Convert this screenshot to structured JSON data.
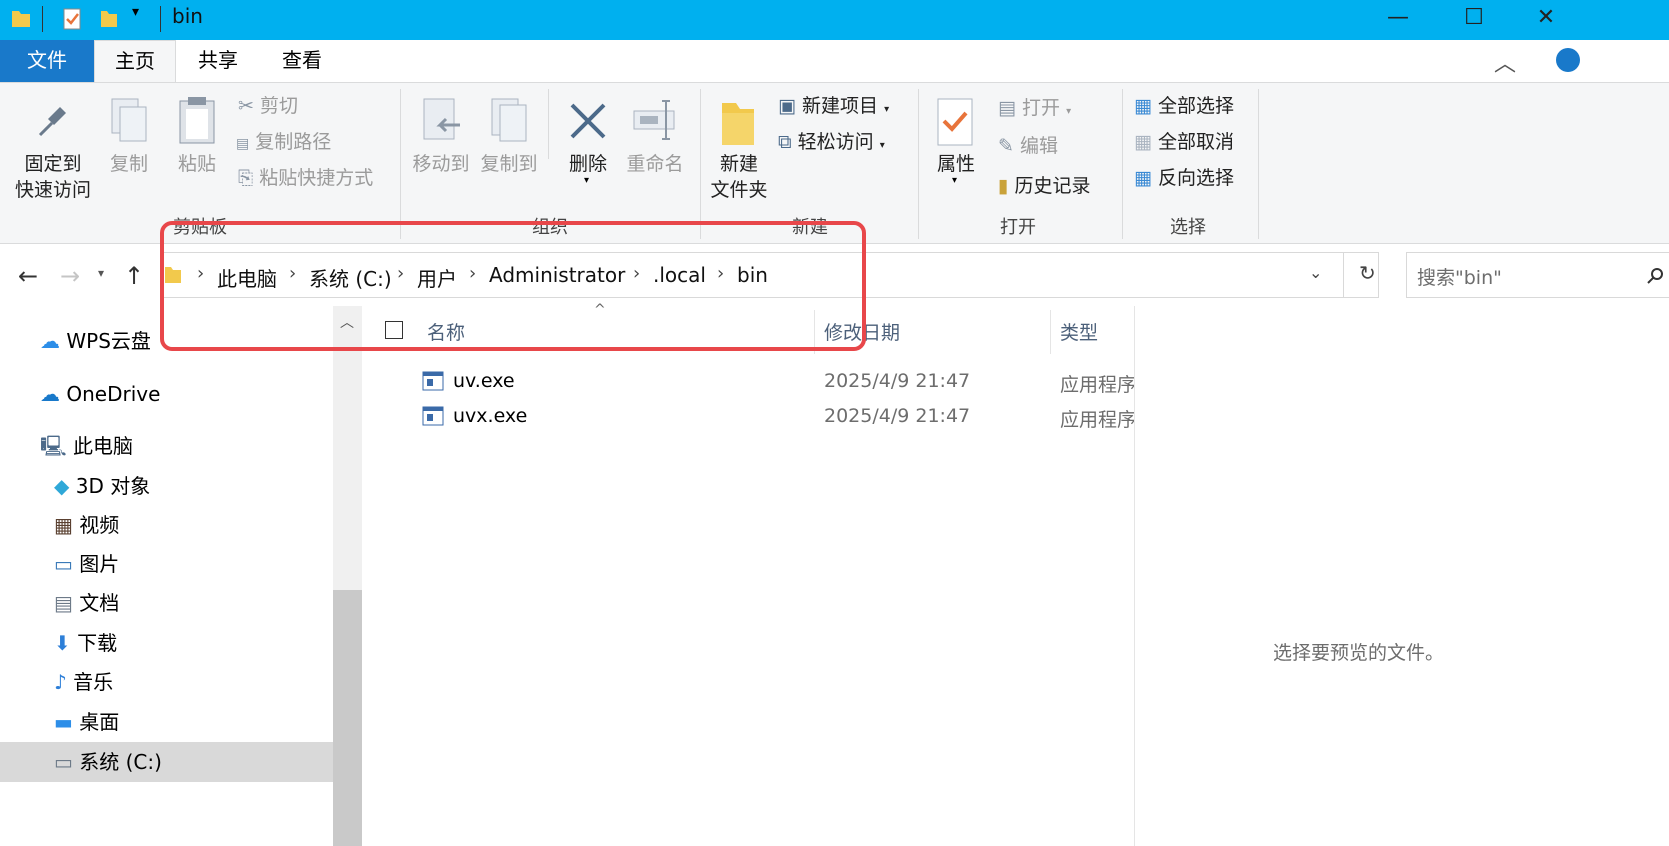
{
  "window": {
    "title": "bin"
  },
  "tabs": {
    "file": "文件",
    "home": "主页",
    "share": "共享",
    "view": "查看"
  },
  "ribbon": {
    "clipboard": {
      "pin_l1": "固定到",
      "pin_l2": "快速访问",
      "copy": "复制",
      "paste": "粘贴",
      "cut": "剪切",
      "copy_path": "复制路径",
      "paste_shortcut": "粘贴快捷方式",
      "group": "剪贴板"
    },
    "organize": {
      "move_to": "移动到",
      "copy_to": "复制到",
      "delete": "删除",
      "rename": "重命名",
      "group": "组织"
    },
    "new": {
      "new_folder_l1": "新建",
      "new_folder_l2": "文件夹",
      "new_item": "新建项目",
      "easy_access": "轻松访问",
      "group": "新建"
    },
    "open": {
      "properties": "属性",
      "open": "打开",
      "edit": "编辑",
      "history": "历史记录",
      "group": "打开"
    },
    "select": {
      "select_all": "全部选择",
      "select_none": "全部取消",
      "invert": "反向选择",
      "group": "选择"
    }
  },
  "address": {
    "crumbs": [
      "此电脑",
      "系统 (C:)",
      "用户",
      "Administrator",
      ".local",
      "bin"
    ],
    "search_placeholder": "搜索\"bin\""
  },
  "nav": {
    "items": [
      "WPS云盘",
      "OneDrive",
      "此电脑",
      "3D 对象",
      "视频",
      "图片",
      "文档",
      "下载",
      "音乐",
      "桌面",
      "系统 (C:)"
    ]
  },
  "columns": {
    "name": "名称",
    "modified": "修改日期",
    "type": "类型"
  },
  "files": [
    {
      "name": "uv.exe",
      "modified": "2025/4/9 21:47",
      "type": "应用程序"
    },
    {
      "name": "uvx.exe",
      "modified": "2025/4/9 21:47",
      "type": "应用程序"
    }
  ],
  "preview": {
    "message": "选择要预览的文件。"
  },
  "colors": {
    "titlebar": "#00b0ef",
    "file_tab": "#1979ca",
    "annotation": "#e8474a"
  }
}
